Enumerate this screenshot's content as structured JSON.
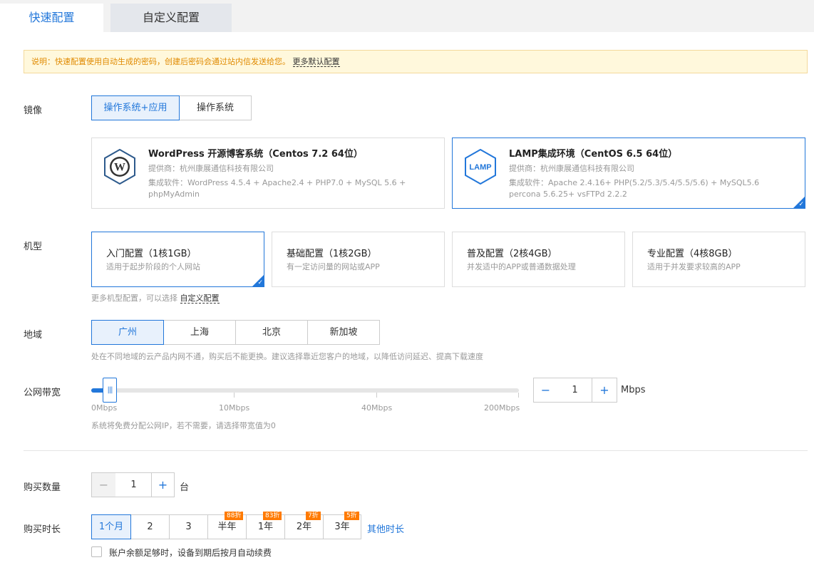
{
  "tabs": {
    "quick": "快速配置",
    "custom": "自定义配置"
  },
  "notice": {
    "text": "说明：快速配置使用自动生成的密码，创建后密码会通过站内信发送给您。",
    "link": "更多默认配置"
  },
  "image": {
    "label": "镜像",
    "modes": [
      "操作系统+应用",
      "操作系统"
    ],
    "cards": [
      {
        "logo": "W",
        "title": "WordPress 开源博客系统（Centos 7.2 64位）",
        "provider": "提供商：杭州康展通信科技有限公司",
        "software": "集成软件：WordPress 4.5.4 + Apache2.4 + PHP7.0 + MySQL 5.6 + phpMyAdmin"
      },
      {
        "logo": "LAMP",
        "title": "LAMP集成环境（CentOS 6.5 64位）",
        "provider": "提供商：杭州康展通信科技有限公司",
        "software": "集成软件：Apache 2.4.16+ PHP(5.2/5.3/5.4/5.5/5.6) + MySQL5.6 percona 5.6.25+ vsFTPd 2.2.2"
      }
    ]
  },
  "instance": {
    "label": "机型",
    "types": [
      {
        "title": "入门配置（1核1GB）",
        "desc": "适用于起步阶段的个人网站"
      },
      {
        "title": "基础配置（1核2GB）",
        "desc": "有一定访问量的网站或APP"
      },
      {
        "title": "普及配置（2核4GB）",
        "desc": "并发适中的APP或普通数据处理"
      },
      {
        "title": "专业配置（4核8GB）",
        "desc": "适用于并发要求较高的APP"
      }
    ],
    "hint": "更多机型配置，可以选择",
    "hint_link": "自定义配置"
  },
  "region": {
    "label": "地域",
    "options": [
      "广州",
      "上海",
      "北京",
      "新加坡"
    ],
    "hint": "处在不同地域的云产品内网不通，购买后不能更换。建议选择靠近您客户的地域，以降低访问延迟、提高下载速度"
  },
  "bandwidth": {
    "label": "公网带宽",
    "ticks": [
      "0Mbps",
      "10Mbps",
      "40Mbps",
      "200Mbps"
    ],
    "value": "1",
    "unit": "Mbps",
    "hint": "系统将免费分配公网IP，若不需要，请选择带宽值为0"
  },
  "quantity": {
    "label": "购买数量",
    "value": "1",
    "unit": "台",
    "minus": "−",
    "plus": "+"
  },
  "duration": {
    "label": "购买时长",
    "options": [
      "1个月",
      "2",
      "3",
      "半年",
      "1年",
      "2年",
      "3年"
    ],
    "badges": [
      "88折",
      "83折",
      "7折",
      "5折"
    ],
    "other": "其他时长",
    "autorenew": "账户余额足够时，设备到期后按月自动续费"
  },
  "colors": {
    "accent": "#2277da",
    "badge": "#ff7a00",
    "notice_bg": "#fff8dc"
  }
}
